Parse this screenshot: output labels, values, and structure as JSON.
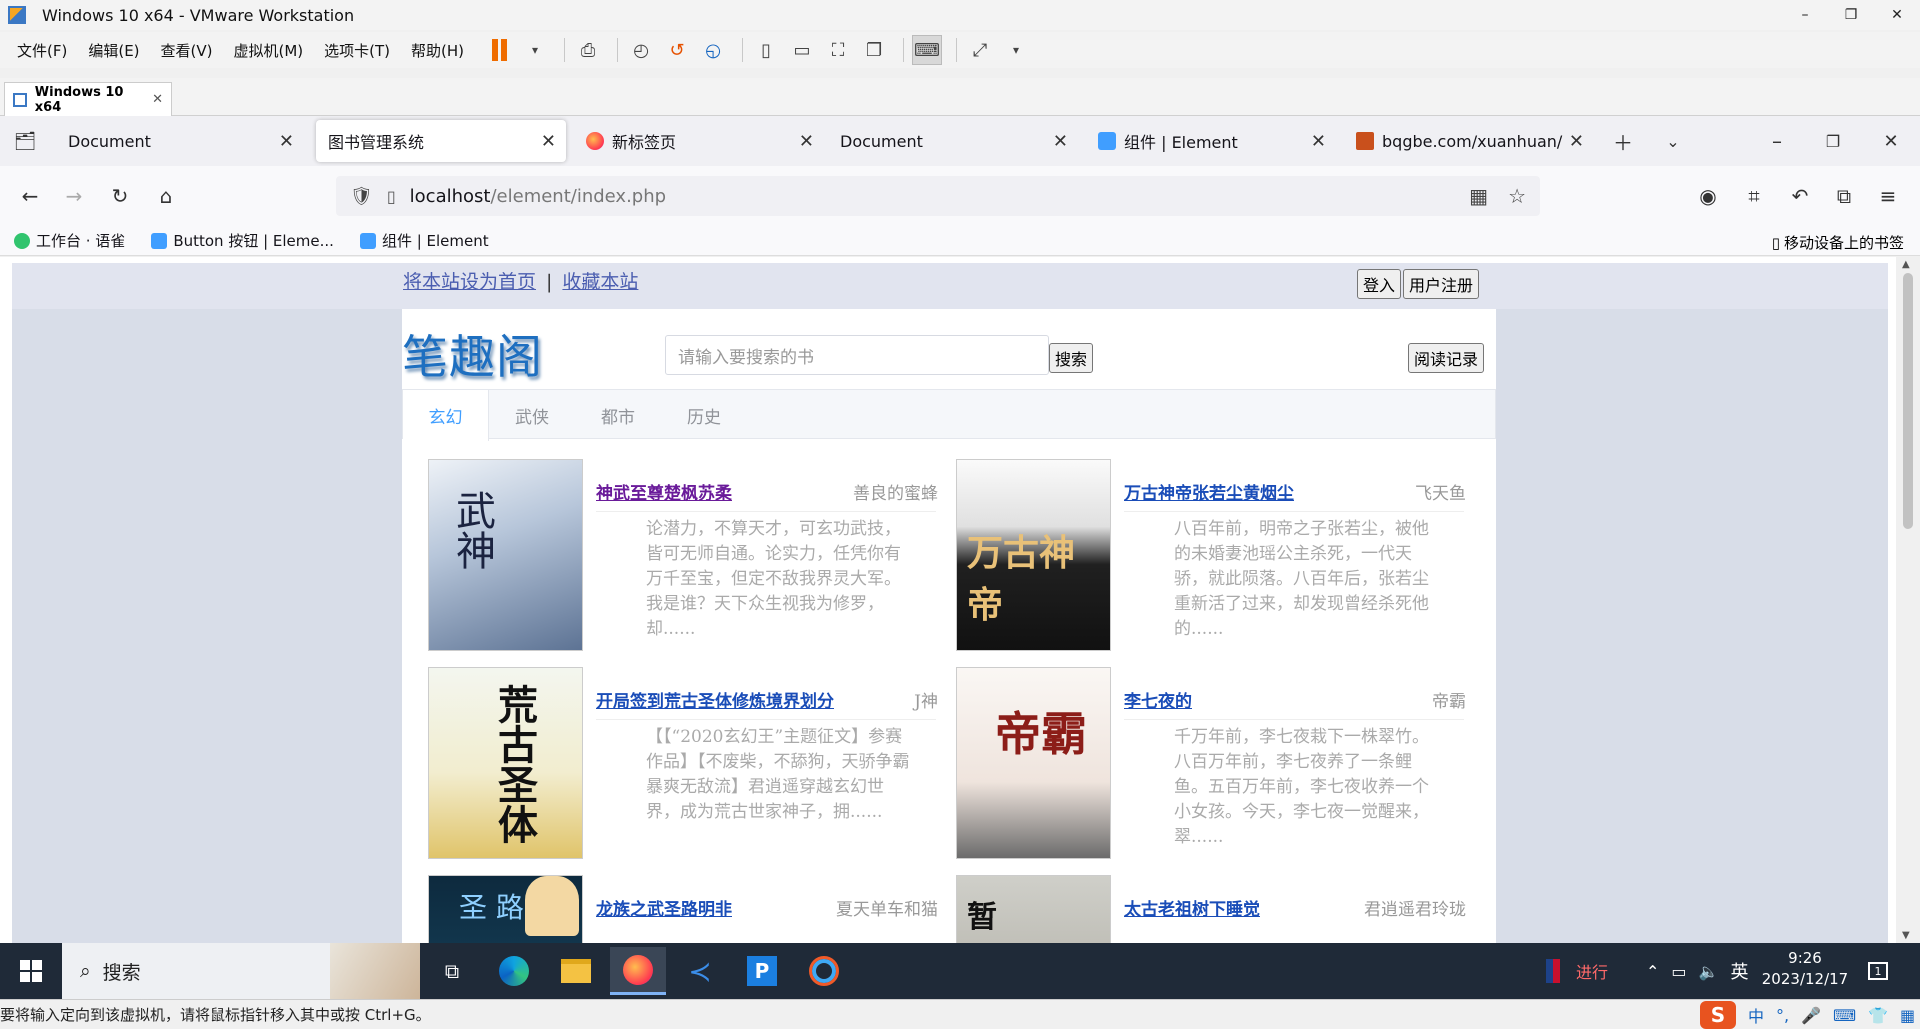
{
  "vmware": {
    "title": "Windows 10 x64 - VMware Workstation",
    "menu": [
      "文件(F)",
      "编辑(E)",
      "查看(V)",
      "虚拟机(M)",
      "选项卡(T)",
      "帮助(H)"
    ],
    "vm_tab": "Windows 10 x64"
  },
  "firefox": {
    "tabs": [
      {
        "label": "Document",
        "active": false
      },
      {
        "label": "图书管理系统",
        "active": true
      },
      {
        "label": "新标签页",
        "active": false
      },
      {
        "label": "Document",
        "active": false
      },
      {
        "label": "组件 | Element",
        "active": false
      },
      {
        "label": "bqgbe.com/xuanhuan/",
        "active": false
      }
    ],
    "url_host": "localhost",
    "url_path": "/element/index.php",
    "bookmarks": [
      "工作台 · 语雀",
      "Button 按钮 | Eleme...",
      "组件 | Element"
    ],
    "mobile_bookmarks": "移动设备上的书签"
  },
  "site": {
    "top_links": [
      "将本站设为首页",
      "收藏本站"
    ],
    "top_sep": "|",
    "login": "登入",
    "register": "用户注册",
    "logo": "笔趣阁",
    "search_placeholder": "请输入要搜索的书",
    "search_button": "搜索",
    "history_button": "阅读记录",
    "tabs": [
      "玄幻",
      "武侠",
      "都市",
      "历史"
    ],
    "active_tab": "玄幻",
    "books": [
      {
        "title": "神武至尊楚枫苏柔",
        "author": "善良的蜜蜂",
        "desc": "论潜力，不算天才，可玄功武技，皆可无师自通。论实力，任凭你有万千至宝，但定不敌我界灵大军。我是谁？天下众生视我为修罗，却......",
        "visited": true
      },
      {
        "title": "万古神帝张若尘黄烟尘",
        "author": "飞天鱼",
        "desc": "八百年前，明帝之子张若尘，被他的未婚妻池瑶公主杀死，一代天骄，就此陨落。八百年后，张若尘重新活了过来，却发现曾经杀死他的......",
        "visited": false
      },
      {
        "title": "开局签到荒古圣体修炼境界划分",
        "author": "J神",
        "desc": "【【“2020玄幻王”主题征文】参赛作品】【不废柴，不舔狗，天骄争霸暴爽无敌流】君逍遥穿越玄幻世界，成为荒古世家神子，拥......",
        "visited": false
      },
      {
        "title": "李七夜的",
        "author": "帝霸",
        "desc": "千万年前，李七夜栽下一株翠竹。八百万年前，李七夜养了一条鲤鱼。五百万年前，李七夜收养一个小女孩。今天，李七夜一觉醒来，翠......",
        "visited": false
      },
      {
        "title": "龙族之武圣路明非",
        "author": "夏天单车和猫",
        "desc": "",
        "visited": false
      },
      {
        "title": "太古老祖树下睡觉",
        "author": "君逍遥君玲珑",
        "desc": "",
        "visited": false
      }
    ]
  },
  "taskbar": {
    "search_label": "搜索",
    "tray_text": "进行",
    "ime_lang": "英",
    "time": "9:26",
    "date": "2023/12/17",
    "notification_count": "1"
  },
  "statusbar": {
    "text": "要将输入定向到该虚拟机，请将鼠标指针移入其中或按 Ctrl+G。",
    "ime_mode": "中"
  }
}
